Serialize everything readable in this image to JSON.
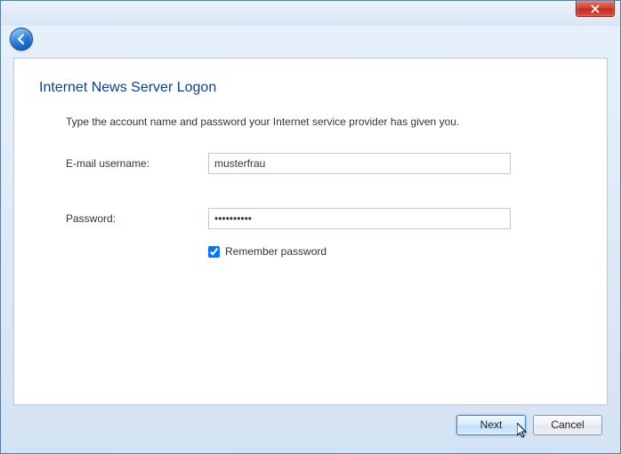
{
  "window": {
    "close_label": "Close"
  },
  "page": {
    "title": "Internet News Server Logon",
    "instruction": "Type the account name and password your Internet service provider has given you."
  },
  "form": {
    "username_label": "E-mail username:",
    "username_value": "musterfrau",
    "password_label": "Password:",
    "password_value": "••••••••••",
    "remember_checked": true,
    "remember_label": "Remember password"
  },
  "buttons": {
    "next": "Next",
    "cancel": "Cancel"
  }
}
